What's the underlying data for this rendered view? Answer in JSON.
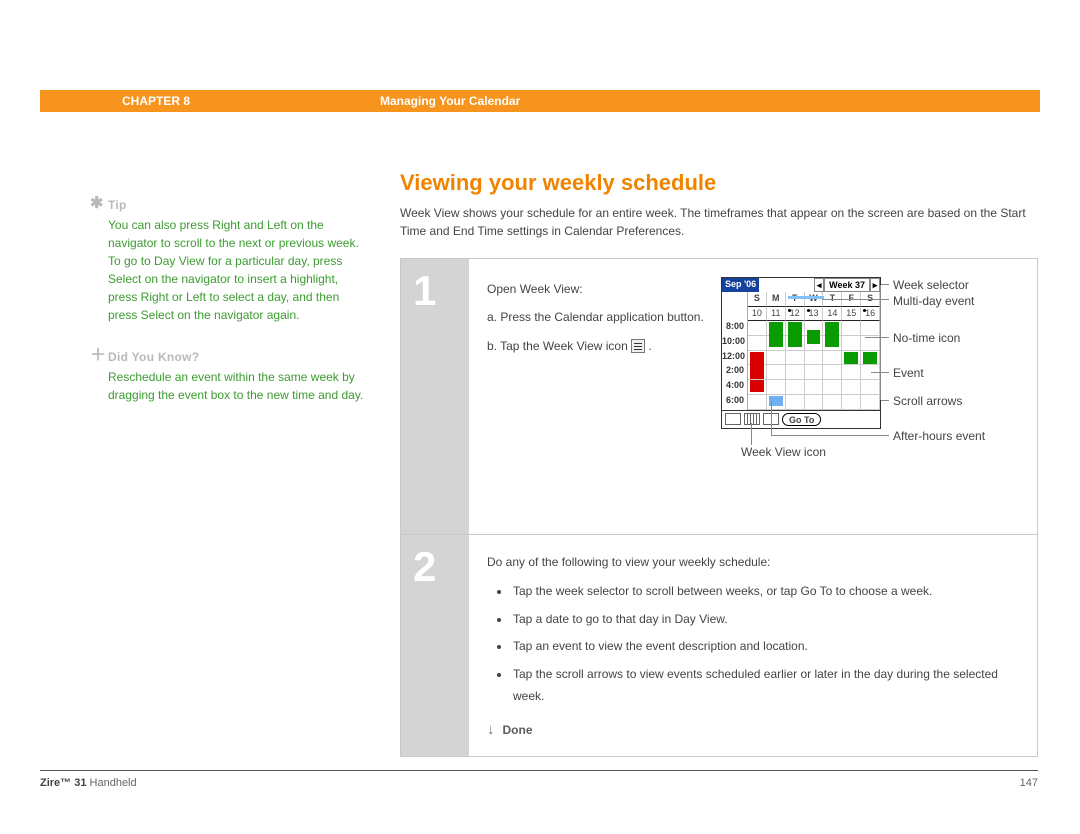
{
  "header": {
    "chapter": "CHAPTER 8",
    "title": "Managing Your Calendar"
  },
  "sidebar": {
    "tip_label": "Tip",
    "tip_body": "You can also press Right and Left on the navigator to scroll to the next or previous week. To go to Day View for a particular day, press Select on the navigator to insert a highlight, press Right or Left to select a day, and then press Select on the navigator again.",
    "dyk_label": "Did You Know?",
    "dyk_body": "Reschedule an event within the same week by dragging the event box to the new time and day."
  },
  "main": {
    "title": "Viewing your weekly schedule",
    "intro": "Week View shows your schedule for an entire week. The timeframes that appear on the screen are based on the Start Time and End Time settings in Calendar Preferences.",
    "step1": {
      "num": "1",
      "lead": "Open Week View:",
      "a": "a.  Press the Calendar application button.",
      "b_pre": "b.  Tap the Week View icon ",
      "b_post": "."
    },
    "step2": {
      "num": "2",
      "lead": "Do any of the following to view your weekly schedule:",
      "bullets": [
        "Tap the week selector to scroll between weeks, or tap Go To to choose a week.",
        "Tap a date to go to that day in Day View.",
        "Tap an event to view the event description and location.",
        "Tap the scroll arrows to view events scheduled earlier or later in the day during the selected week."
      ],
      "done": "Done"
    }
  },
  "screenshot": {
    "month": "Sep '06",
    "week": "Week 37",
    "day_labels": [
      "S",
      "M",
      "T",
      "W",
      "T",
      "F",
      "S"
    ],
    "dates": [
      "10",
      "11",
      "12",
      "13",
      "14",
      "15",
      "16"
    ],
    "times": [
      "8:00",
      "10:00",
      "12:00",
      "2:00",
      "4:00",
      "6:00"
    ],
    "goto": "Go To"
  },
  "callouts": {
    "week_selector": "Week selector",
    "multi_day": "Multi-day event",
    "no_time": "No-time icon",
    "event": "Event",
    "scroll_arrows": "Scroll arrows",
    "after_hours": "After-hours event",
    "week_icon": "Week View icon"
  },
  "footer": {
    "product_bold": "Zire™ 31",
    "product_rest": " Handheld",
    "page": "147"
  }
}
